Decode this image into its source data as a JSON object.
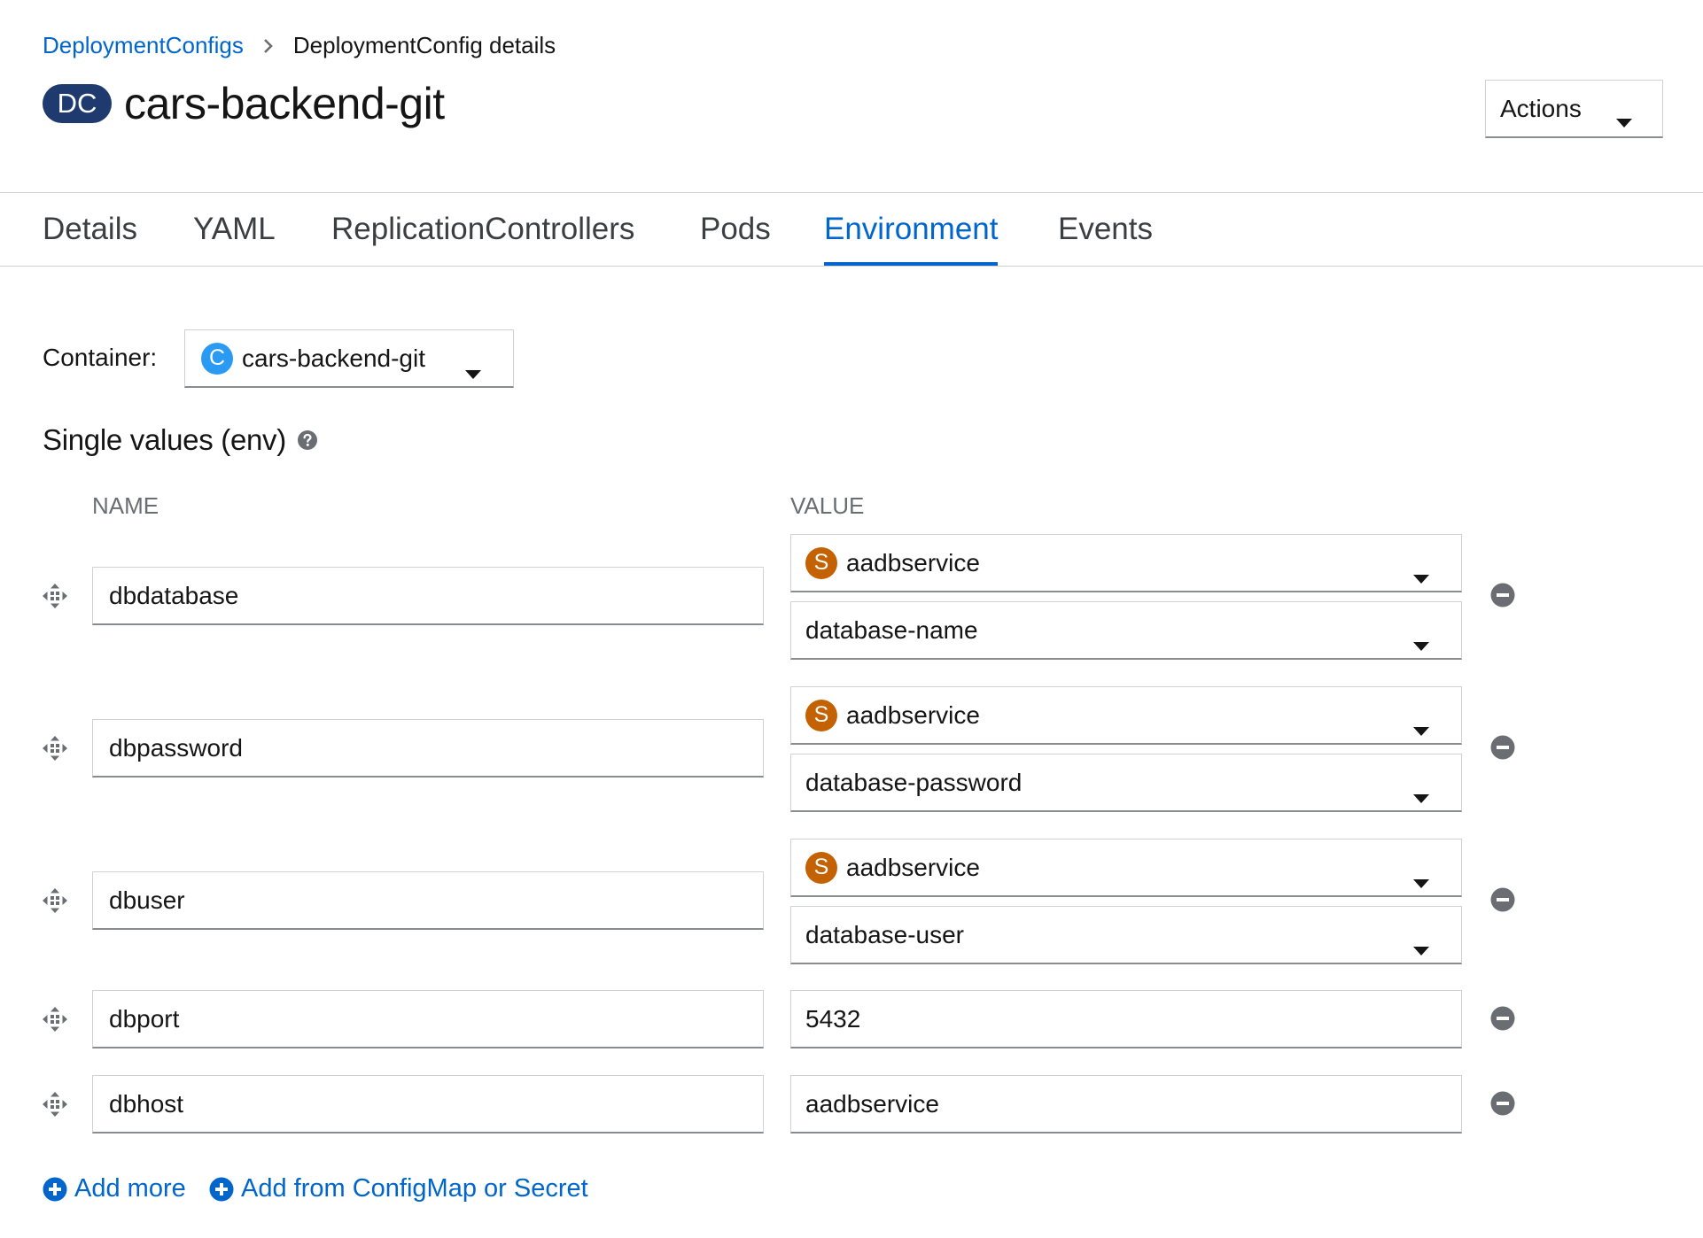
{
  "breadcrumb": {
    "parent": "DeploymentConfigs",
    "current": "DeploymentConfig details"
  },
  "header": {
    "badge": "DC",
    "title": "cars-backend-git",
    "actions_label": "Actions"
  },
  "tabs": [
    {
      "label": "Details"
    },
    {
      "label": "YAML"
    },
    {
      "label": "ReplicationControllers"
    },
    {
      "label": "Pods"
    },
    {
      "label": "Environment",
      "active": true
    },
    {
      "label": "Events"
    }
  ],
  "container": {
    "label": "Container:",
    "badge": "C",
    "value": "cars-backend-git"
  },
  "section": {
    "title": "Single values (env)",
    "name_header": "NAME",
    "value_header": "VALUE"
  },
  "env": [
    {
      "name": "dbdatabase",
      "source_badge": "S",
      "source": "aadbservice",
      "key": "database-name"
    },
    {
      "name": "dbpassword",
      "source_badge": "S",
      "source": "aadbservice",
      "key": "database-password"
    },
    {
      "name": "dbuser",
      "source_badge": "S",
      "source": "aadbservice",
      "key": "database-user"
    },
    {
      "name": "dbport",
      "value": "5432"
    },
    {
      "name": "dbhost",
      "value": "aadbservice"
    }
  ],
  "footer": {
    "add_more": "Add more",
    "add_from": "Add from ConfigMap or Secret"
  },
  "colors": {
    "link": "#0066cc",
    "dc_badge": "#1e3a6e",
    "container_badge": "#2b9af3",
    "secret_badge": "#c46100"
  }
}
